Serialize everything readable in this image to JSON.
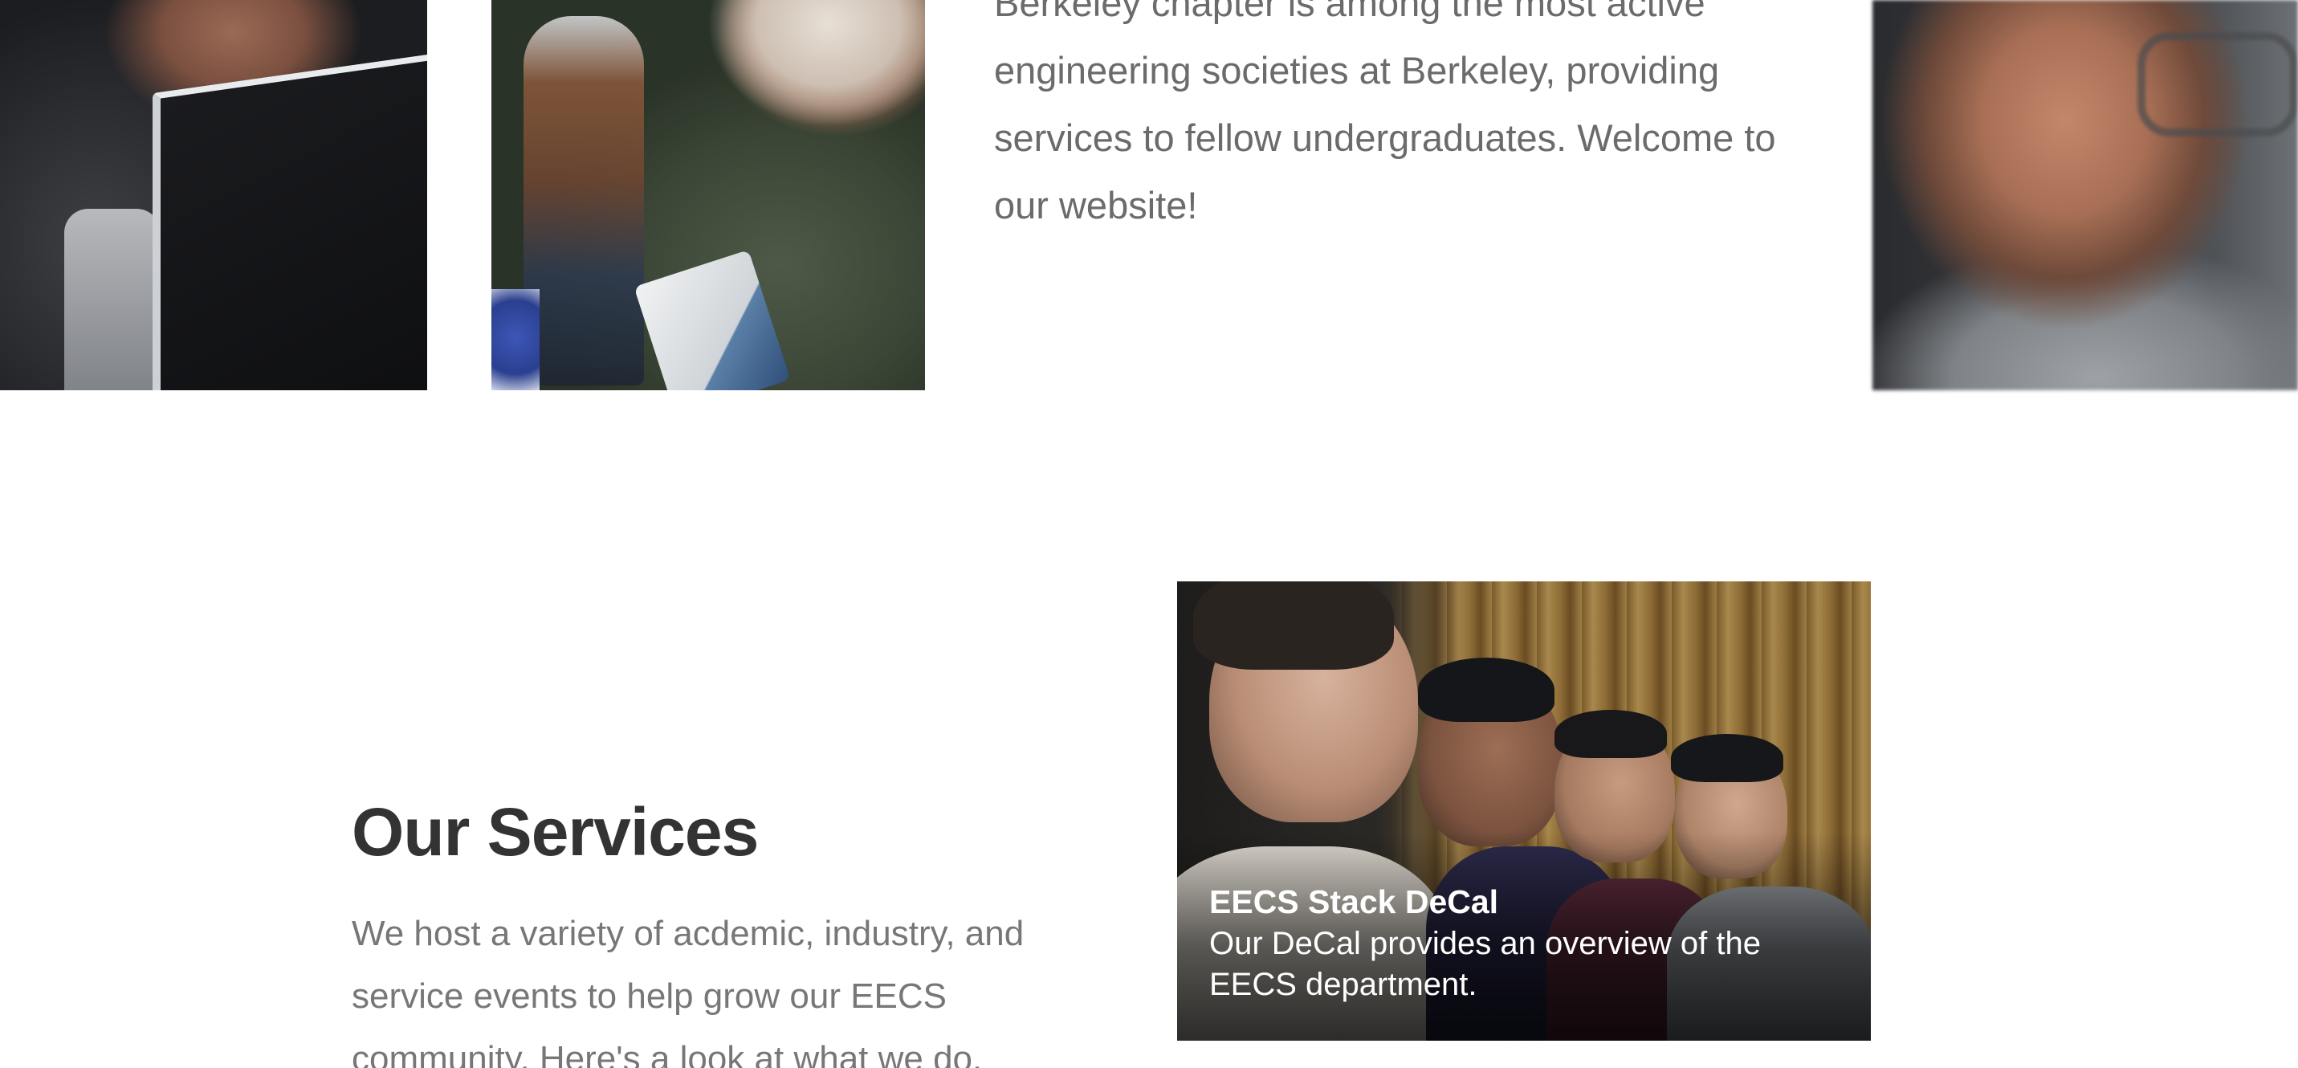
{
  "intro": {
    "text": "Berkeley chapter is among the most active engineering societies at Berkeley, providing services to fellow undergraduates. Welcome to our website!"
  },
  "services": {
    "title": "Our Services",
    "description": "We host a variety of acdemic, industry, and service events to help grow our EECS community. Here's a look at what we do."
  },
  "service_cards": [
    {
      "title": "EECS Stack DeCal",
      "description": "Our DeCal provides an overview of the EECS department."
    }
  ]
}
